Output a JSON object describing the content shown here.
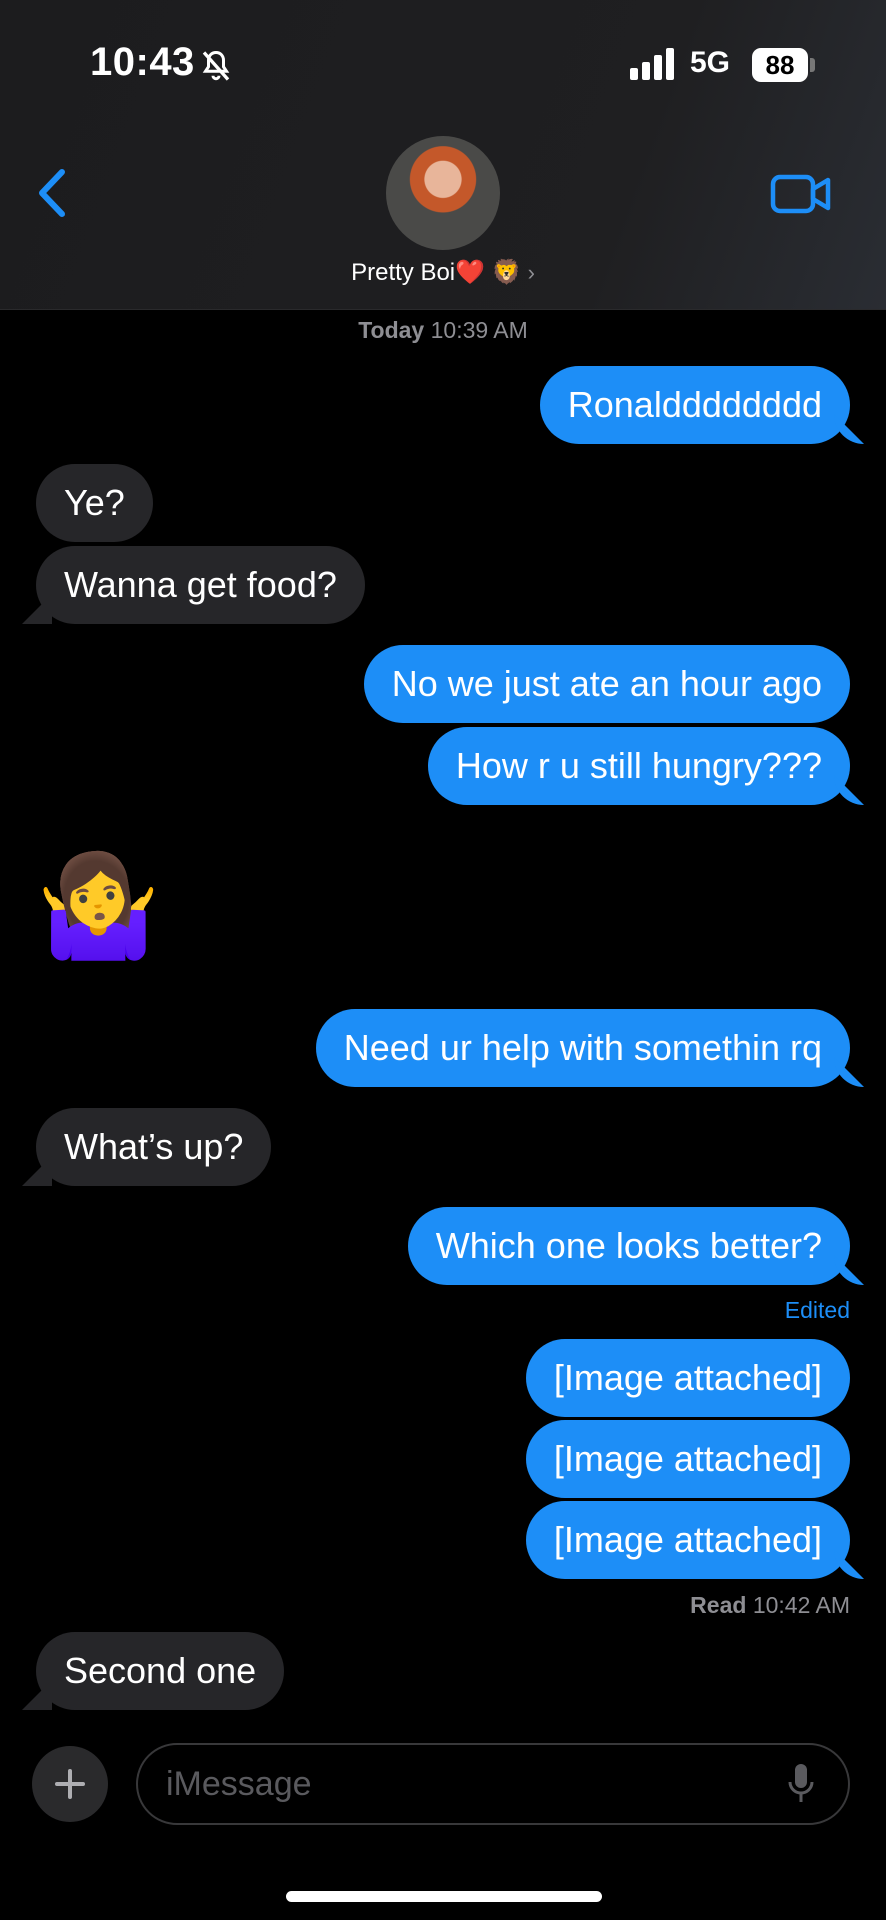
{
  "status_bar": {
    "time": "10:43",
    "network": "5G",
    "battery": "88"
  },
  "header": {
    "contact_name": "Pretty Boi❤️ 🦁",
    "chevron": "›"
  },
  "timestamp": {
    "day": "Today",
    "time": "10:39 AM"
  },
  "messages": [
    {
      "from": "me",
      "text": "Ronaldddddddd"
    },
    {
      "from": "them",
      "text": "Ye?"
    },
    {
      "from": "them",
      "text": "Wanna get food?"
    },
    {
      "from": "me",
      "text": "No we just ate an hour ago"
    },
    {
      "from": "me",
      "text": "How r u still hungry???"
    },
    {
      "from": "them",
      "text": "🤷‍♀️"
    },
    {
      "from": "me",
      "text": "Need ur help with somethin rq"
    },
    {
      "from": "them",
      "text": "What’s up?"
    },
    {
      "from": "me",
      "text": "Which one looks better?"
    },
    {
      "from": "me",
      "text": "[Image attached]"
    },
    {
      "from": "me",
      "text": "[Image attached]"
    },
    {
      "from": "me",
      "text": "[Image attached]"
    },
    {
      "from": "them",
      "text": "Second one"
    }
  ],
  "edited_label": "Edited",
  "read_receipt": {
    "label": "Read",
    "time": "10:42 AM"
  },
  "input": {
    "placeholder": "iMessage"
  },
  "colors": {
    "sent_bubble": "#1d8ef7",
    "received_bubble": "#262629",
    "accent": "#1d8ef7"
  }
}
